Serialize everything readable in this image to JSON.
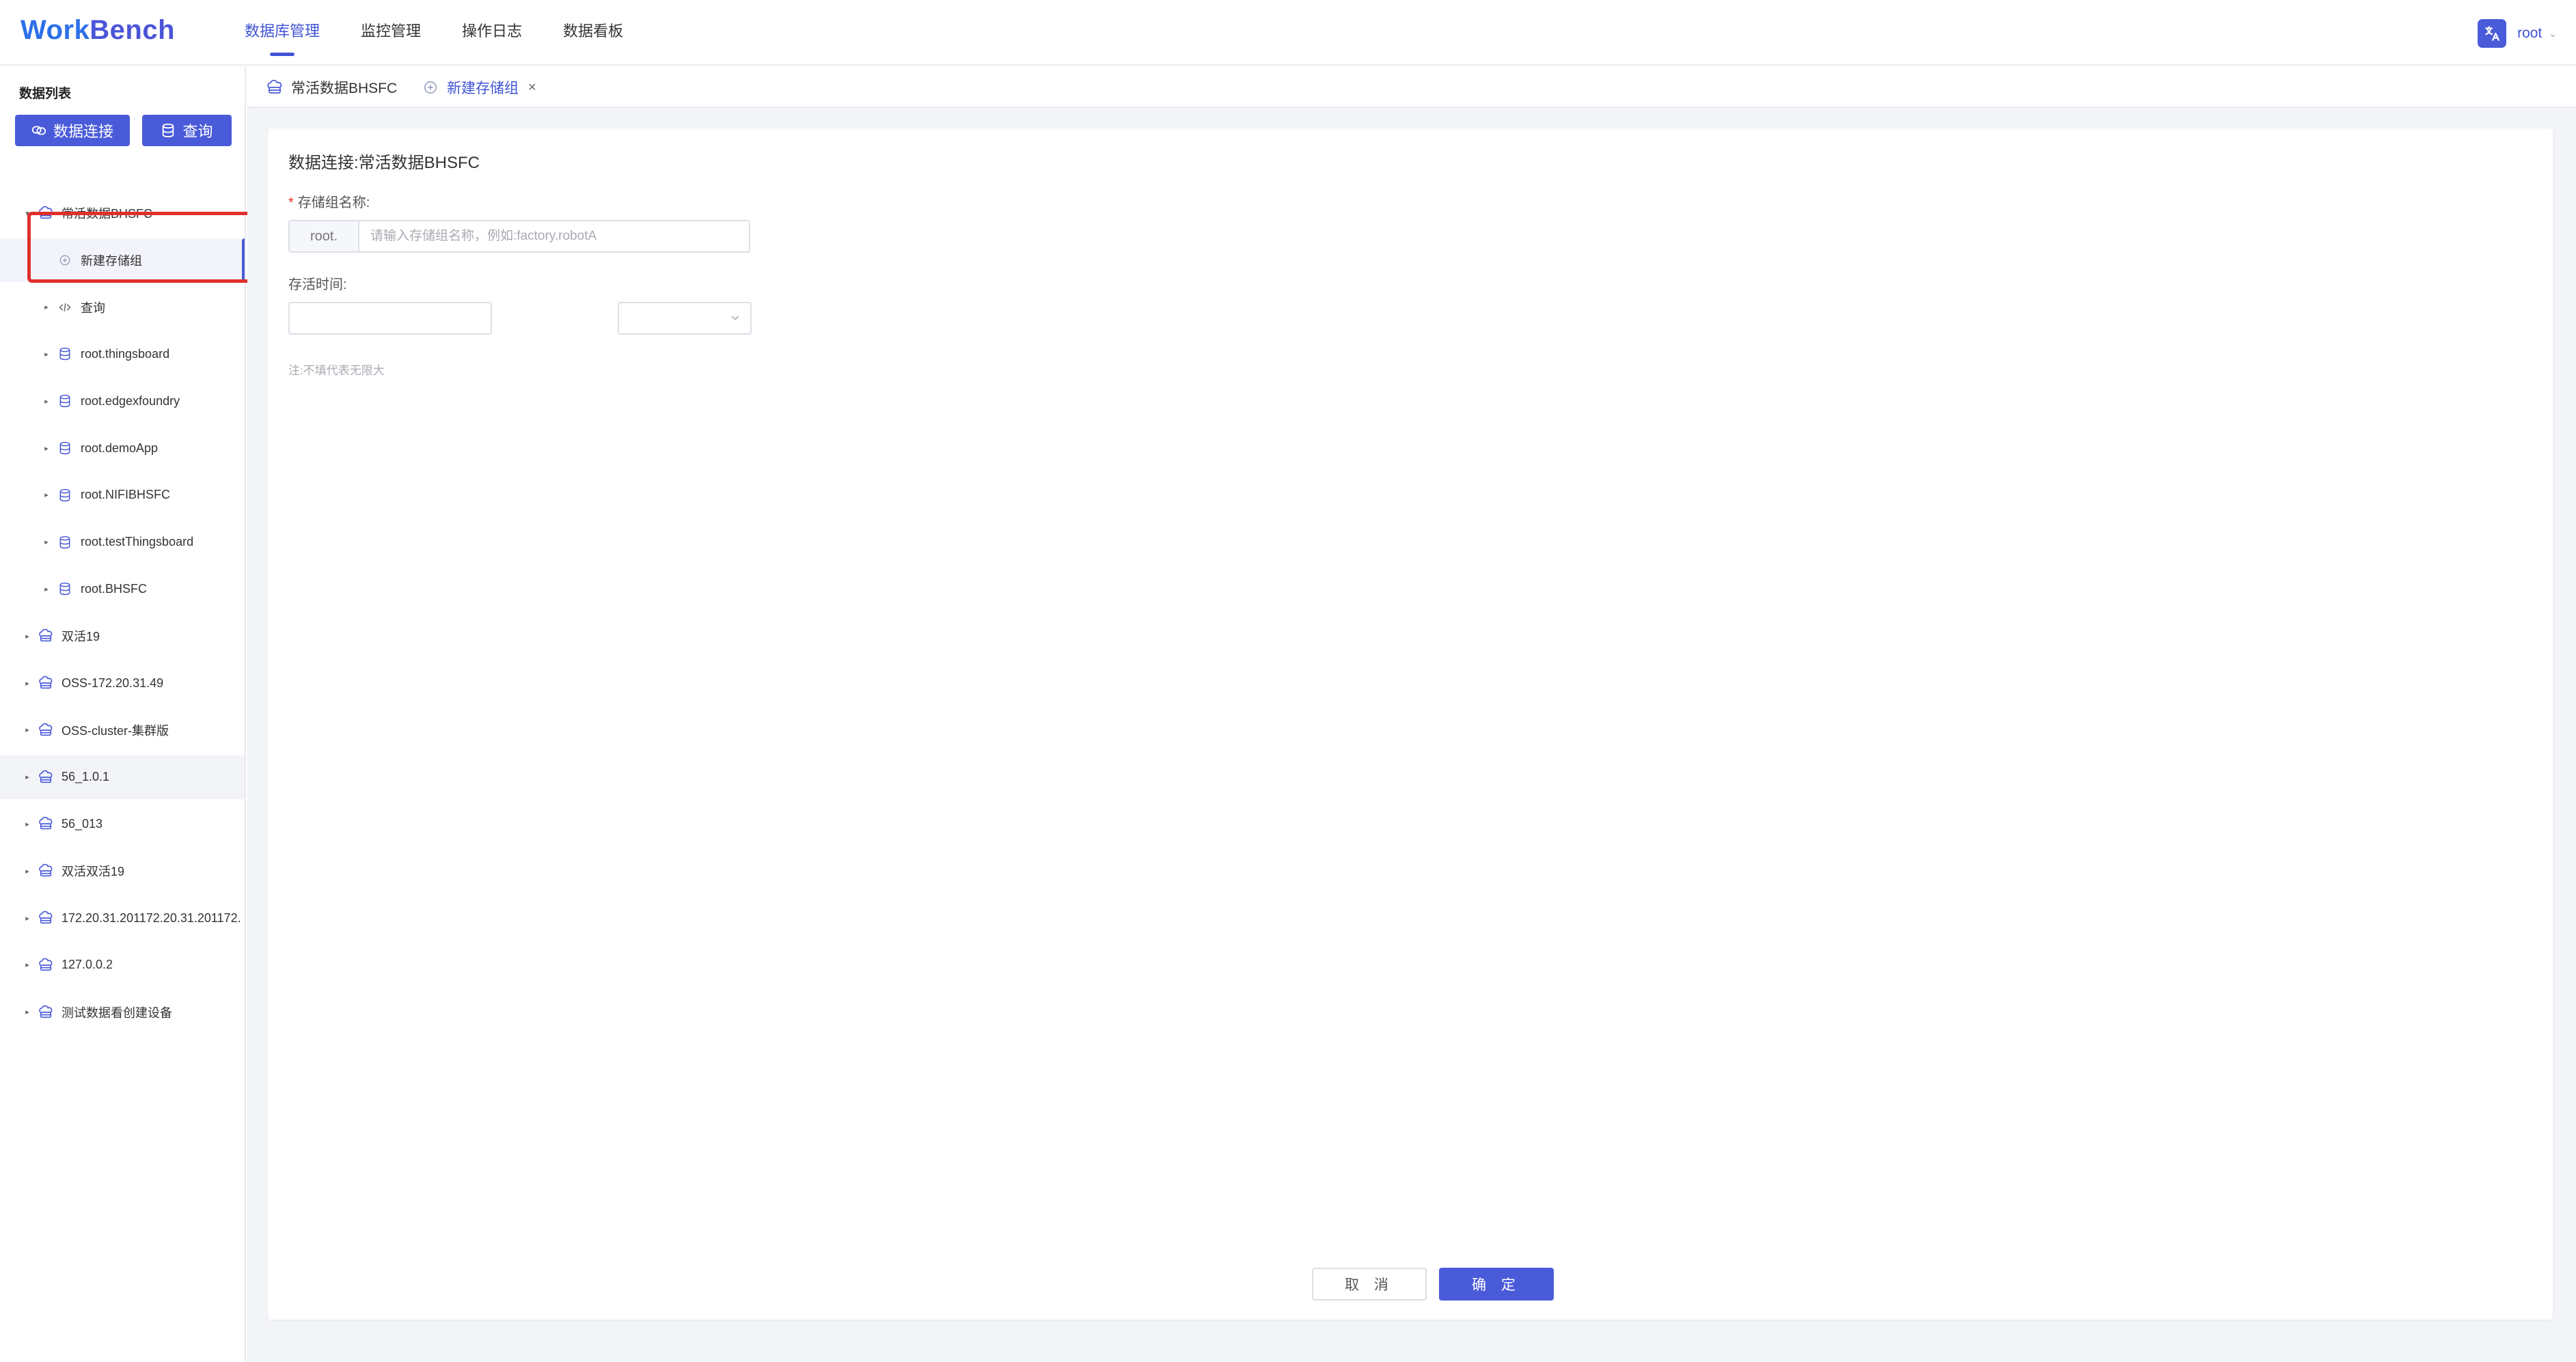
{
  "header": {
    "logo_text_1": "Work",
    "logo_text_2": "Bench",
    "nav": [
      {
        "label": "数据库管理",
        "active": true
      },
      {
        "label": "监控管理"
      },
      {
        "label": "操作日志"
      },
      {
        "label": "数据看板"
      }
    ],
    "lang_icon": "文A",
    "user": "root"
  },
  "sidebar": {
    "title": "数据列表",
    "connect_button": "数据连接",
    "query_button": "查询",
    "tree": [
      {
        "label": "常活数据BHSFC",
        "level": 0,
        "expanded": true,
        "icon": "cloud-db-icon"
      },
      {
        "label": "新建存储组",
        "level": 1,
        "icon": "plus-circle-icon",
        "selected": true
      },
      {
        "label": "查询",
        "level": 1,
        "icon": "code-icon"
      },
      {
        "label": "root.thingsboard",
        "level": 1,
        "icon": "database-icon"
      },
      {
        "label": "root.edgexfoundry",
        "level": 1,
        "icon": "database-icon"
      },
      {
        "label": "root.demoApp",
        "level": 1,
        "icon": "database-icon"
      },
      {
        "label": "root.NIFIBHSFC",
        "level": 1,
        "icon": "database-icon"
      },
      {
        "label": "root.testThingsboard",
        "level": 1,
        "icon": "database-icon"
      },
      {
        "label": "root.BHSFC",
        "level": 1,
        "icon": "database-icon"
      },
      {
        "label": "双活19",
        "level": 0,
        "icon": "cloud-db-icon"
      },
      {
        "label": "OSS-172.20.31.49",
        "level": 0,
        "icon": "cloud-db-icon"
      },
      {
        "label": "OSS-cluster-集群版",
        "level": 0,
        "icon": "cloud-db-icon"
      },
      {
        "label": "56_1.0.1",
        "level": 0,
        "icon": "cloud-db-icon",
        "hover": true
      },
      {
        "label": "56_013",
        "level": 0,
        "icon": "cloud-db-icon"
      },
      {
        "label": "双活双活19",
        "level": 0,
        "icon": "cloud-db-icon"
      },
      {
        "label": "172.20.31.201172.20.31.201172.",
        "level": 0,
        "icon": "cloud-db-icon"
      },
      {
        "label": "127.0.0.2",
        "level": 0,
        "icon": "cloud-db-icon"
      },
      {
        "label": "测试数据看创建设备",
        "level": 0,
        "icon": "cloud-db-icon"
      }
    ]
  },
  "tabs": [
    {
      "label": "常活数据BHSFC",
      "icon": "cloud-db-icon"
    },
    {
      "label": "新建存储组",
      "icon": "plus-circle-icon",
      "active": true,
      "close": "×"
    }
  ],
  "form": {
    "title": "数据连接:常活数据BHSFC",
    "name_label": "存储组名称:",
    "required_mark": "*",
    "name_prefix": "root.",
    "name_placeholder": "请输入存储组名称，例如:factory.robotA",
    "ttl_label": "存活时间:",
    "ttl_value": "",
    "ttl_unit": "",
    "hint": "注:不填代表无限大",
    "cancel": "取 消",
    "confirm": "确 定"
  },
  "colors": {
    "primary": "#4a5bd9",
    "highlight": "#e0302a"
  }
}
